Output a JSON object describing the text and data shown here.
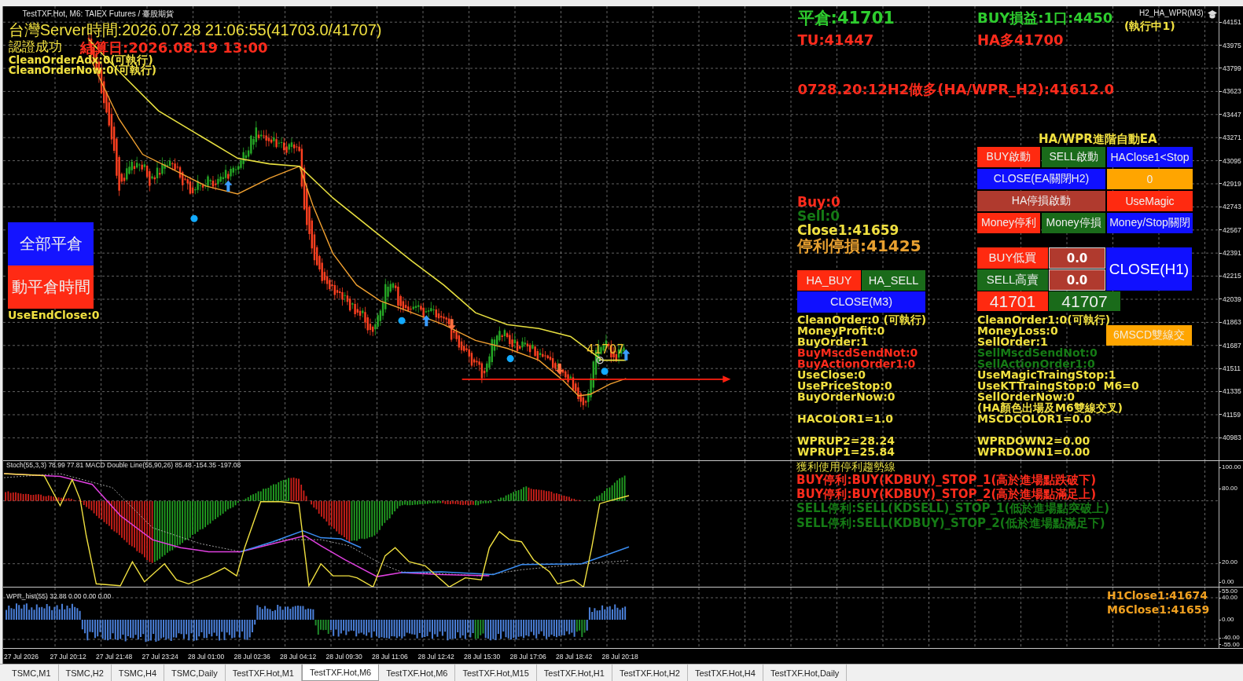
{
  "chart_title": "TestTXF.Hot, M6:  TAIEX Futures / 臺股期貨",
  "header_left": {
    "server_time": "台灣Server時間:2026.07.28 21:06:55(41703.0/41707)",
    "auth_status": "認證成功",
    "settlement_date": "結算日:2026.08.19 13:00",
    "flags": [
      "CleanOrderAdx:0(可執行)",
      "CleanOrderNow:0(可執行)"
    ]
  },
  "header_right": {
    "close_price": "平倉:41701",
    "profit": "BUY損益:1口:4450",
    "running": "(執行中1)",
    "expert_name": "H2_HA_WPR(M3)",
    "tu": "TU:41447",
    "ha_long": "HA多41700",
    "signal": "0728.20:12H2做多(HA/WPR_H2):41612.0"
  },
  "left_buttons": [
    {
      "label": "全部平倉",
      "color": "#1414ff"
    },
    {
      "label": "動平倉時間",
      "color": "#ff2a14"
    }
  ],
  "use_end_close": "UseEndClose:0",
  "price_marker": "41707",
  "summary": [
    {
      "text": "Buy:0",
      "color": "#ff2b1c",
      "kind": "normal"
    },
    {
      "text": "Sell:0",
      "color": "#157a15",
      "kind": "normal"
    },
    {
      "text": "Close1:41659",
      "color": "#f0e040",
      "kind": "normal"
    },
    {
      "text": "停利停損:41425",
      "color": "#e8a030",
      "kind": "large"
    }
  ],
  "ha_buttons": [
    {
      "label": "HA_BUY",
      "color": "#ff2a10"
    },
    {
      "label": "HA_SELL",
      "color": "#1a6b1a"
    }
  ],
  "close_m3": {
    "label": "CLOSE(M3)",
    "color": "#1010ff"
  },
  "ea_panel": {
    "title": "HA/WPR進階自動EA",
    "rows": [
      [
        {
          "label": "BUY啟動",
          "color": "#ff2a10"
        },
        {
          "label": "SELL啟動",
          "color": "#1a6b1a"
        },
        {
          "label": "HAClose1<Stop",
          "color": "#1010ff"
        }
      ],
      [
        {
          "label": "CLOSE(EA關閉H2)",
          "color": "#1010ff"
        },
        {
          "label": "0",
          "color": "#ffa500"
        }
      ],
      [
        {
          "label": "HA停損啟動",
          "color": "#b03a2e"
        },
        {
          "label": "UseMagic",
          "color": "#ff2a10"
        }
      ],
      [
        {
          "label": "Money停利",
          "color": "#ff2a10"
        },
        {
          "label": "Money停損",
          "color": "#1a6b1a"
        },
        {
          "label": "Money/Stop關閉",
          "color": "#1010ff"
        }
      ]
    ]
  },
  "order_panel": {
    "rows": [
      {
        "label": "BUY低買",
        "color": "#ff2a10",
        "value": "0.0"
      },
      {
        "label": "SELL高賣",
        "color": "#1a6b1a",
        "value": "0.0"
      }
    ],
    "close_button": {
      "label": "CLOSE(H1)",
      "color": "#1010ff"
    },
    "prices": [
      {
        "text": "41701",
        "color": "#ff2a10"
      },
      {
        "text": "41707",
        "color": "#1a6b1a"
      }
    ]
  },
  "msc_button": {
    "label": "6MSCD雙線交",
    "color": "#ffa500"
  },
  "status_left": [
    [
      {
        "text": "CleanOrder:0 (可執行)",
        "color": "#f0e040"
      },
      {
        "text": "MoneyProfit:0",
        "color": "#f0e040"
      },
      {
        "text": "BuyOrder:1",
        "color": "#f0e040"
      },
      {
        "text": "BuyMscdSendNot:0",
        "color": "#ff2b1c"
      },
      {
        "text": "BuyActionOrder1:0",
        "color": "#ff2b1c"
      },
      {
        "text": "UseClose:0",
        "color": "#f0e040"
      },
      {
        "text": "UsePriceStop:0",
        "color": "#f0e040"
      },
      {
        "text": "BuyOrderNow:0",
        "color": "#f0e040"
      }
    ],
    [
      {
        "text": "HACOLOR1=1.0",
        "color": "#f0e040"
      }
    ],
    [
      {
        "text": "WPRUP2=28.24",
        "color": "#f0e040"
      },
      {
        "text": "WPRUP1=25.84",
        "color": "#f0e040"
      }
    ]
  ],
  "status_right": [
    [
      {
        "text": "CleanOrder1:0(可執行)",
        "color": "#f0e040"
      },
      {
        "text": "MoneyLoss:0",
        "color": "#f0e040"
      },
      {
        "text": "SellOrder:1",
        "color": "#f0e040"
      },
      {
        "text": "SellMscdSendNot:0",
        "color": "#157a15"
      },
      {
        "text": "SellActionOrder1:0",
        "color": "#157a15"
      },
      {
        "text": "UseMagicTraingStop:1",
        "color": "#f0e040"
      },
      {
        "text": "UseKTTraingStop:0  M6=0",
        "color": "#f0e040"
      },
      {
        "text": "SellOrderNow:0",
        "color": "#f0e040"
      },
      {
        "text": "(HA顏色出場及M6雙線交叉)",
        "color": "#f0e040"
      },
      {
        "text": "MSCDCOLOR1=0.0",
        "color": "#f0e040"
      }
    ],
    [
      {
        "text": "WPRDOWN2=0.00",
        "color": "#f0e040"
      },
      {
        "text": "WPRDOWN1=0.00",
        "color": "#f0e040"
      }
    ]
  ],
  "take_profit_notes": [
    {
      "text": "獲利使用停利趨勢線",
      "color": "#e0d840",
      "kind": "heading"
    },
    {
      "text": "BUY停利:BUY(KDBUY)_STOP_1(高於進場點跌破下)",
      "color": "#ff2b1c",
      "kind": "rule"
    },
    {
      "text": "BUY停利:BUY(KDBUY)_STOP_2(高於進場點滿足上)",
      "color": "#ff2b1c",
      "kind": "rule"
    },
    {
      "text": "SELL停利:SELL(KDSELL)_STOP_1(低於進場點突破上)",
      "color": "#157a15",
      "kind": "rule"
    },
    {
      "text": "SELL停利:SELL(KDBUY)_STOP_2(低於進場點滿足下)",
      "color": "#157a15",
      "kind": "rule"
    }
  ],
  "close_readouts": [
    "H1Close1:41674",
    "M6Close1:41659"
  ],
  "price_axis": [
    "44151",
    "43975",
    "43799",
    "43623",
    "43447",
    "43271",
    "43095",
    "42919",
    "42743",
    "42567",
    "42391",
    "42215",
    "42039",
    "41863",
    "41687",
    "41511",
    "41335",
    "41159",
    "40983"
  ],
  "oscillator": {
    "label": "Stoch(55,3,3) 78.99 77.81 MACD Double Line(55,90,26) 85.48 -154.35 -197.08",
    "axis": [
      "100.00",
      "80.00",
      "20.00",
      "0.00"
    ]
  },
  "wpr": {
    "label": "WPR_hist(55) 32.88 0.00 0.00 0.00",
    "axis": [
      "55.00",
      "40.00",
      "0.00",
      "-40.00",
      "-55.00"
    ]
  },
  "time_axis": [
    "27 Jul 2026",
    "27 Jul 20:12",
    "27 Jul 21:48",
    "27 Jul 23:24",
    "28 Jul 01:00",
    "28 Jul 02:36",
    "28 Jul 04:12",
    "28 Jul 09:30",
    "28 Jul 11:06",
    "28 Jul 12:42",
    "28 Jul 15:30",
    "28 Jul 17:06",
    "28 Jul 18:42",
    "28 Jul 20:18"
  ],
  "tabs": [
    {
      "label": "TSMC,M1",
      "selected": false
    },
    {
      "label": "TSMC,H2",
      "selected": false
    },
    {
      "label": "TSMC,H4",
      "selected": false
    },
    {
      "label": "TSMC,Daily",
      "selected": false
    },
    {
      "label": "TestTXF.Hot,M1",
      "selected": false
    },
    {
      "label": "TestTXF.Hot,M6",
      "selected": true
    },
    {
      "label": "TestTXF.Hot,M6",
      "selected": false
    },
    {
      "label": "TestTXF.Hot,M15",
      "selected": false
    },
    {
      "label": "TestTXF.Hot,H1",
      "selected": false
    },
    {
      "label": "TestTXF.Hot,H2",
      "selected": false
    },
    {
      "label": "TestTXF.Hot,H4",
      "selected": false
    },
    {
      "label": "TestTXF.Hot,Daily",
      "selected": false
    }
  ]
}
